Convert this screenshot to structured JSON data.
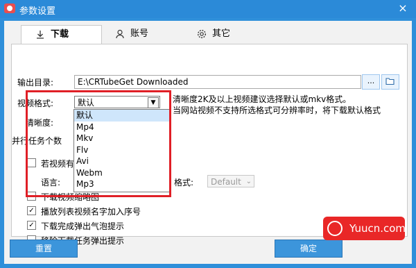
{
  "window": {
    "title": "参数设置",
    "close_label": "×"
  },
  "tabs": [
    {
      "label": "下载",
      "icon": "download-icon"
    },
    {
      "label": "账号",
      "icon": "user-icon"
    },
    {
      "label": "其它",
      "icon": "gear-icon"
    }
  ],
  "download": {
    "output_dir_label": "输出目录:",
    "output_dir_value": "E:\\CRTubeGet Downloaded",
    "browse_label": "...",
    "video_format_label": "视频格式:",
    "video_format_value": "默认",
    "format_hint_line1": "清晰度2K及以上视频建议选择默认或mkv格式。",
    "format_hint_line2": "当网站视频不支持所选格式可分辨率时，将下载默认格式",
    "format_options": [
      "默认",
      "Mp4",
      "Mkv",
      "Flv",
      "Avi",
      "Webm",
      "Mp3"
    ],
    "quality_label": "清晰度:",
    "parallel_label": "并行任务个数",
    "subtitle_checkbox_label": "若视频有字",
    "language_label": "语言:",
    "subtitle_format_label": "格式:",
    "subtitle_format_value": "Default",
    "hidden_option_label": "下载视频缩略图",
    "options": [
      {
        "label": "播放列表视频名字加入序号",
        "checked": true
      },
      {
        "label": "下载完成弹出气泡提示",
        "checked": true
      },
      {
        "label": "移除下载任务弹出提示",
        "checked": false
      }
    ]
  },
  "footer": {
    "reset_label": "重置",
    "ok_label": "确定"
  },
  "watermark": {
    "text": "Yuucn.com"
  },
  "colors": {
    "accent": "#2b8ad8",
    "highlight_frame": "#e01f26",
    "watermark": "#e92727"
  }
}
